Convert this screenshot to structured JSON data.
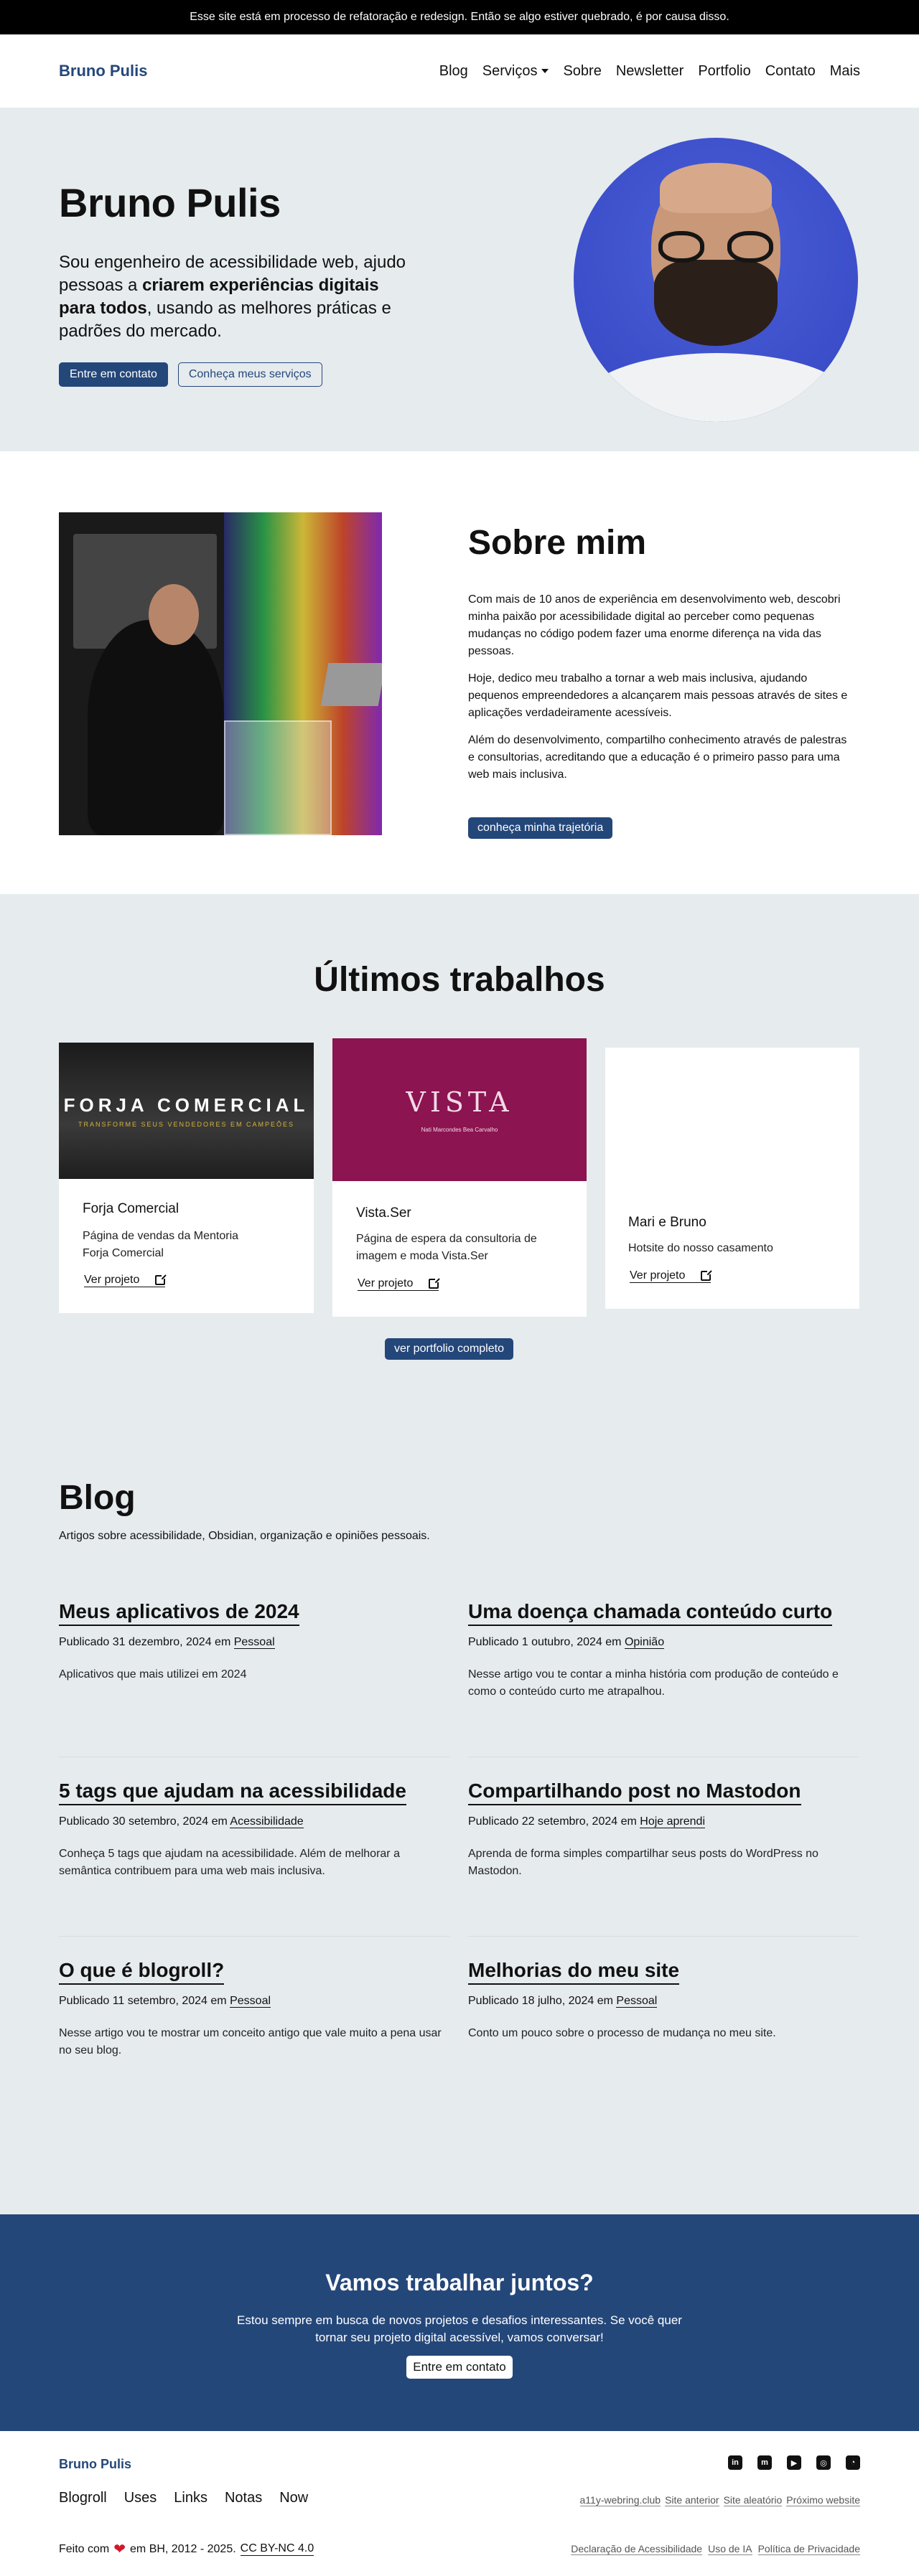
{
  "banner": "Esse site está em processo de refatoração e redesign. Então se algo estiver quebrado, é por causa disso.",
  "header": {
    "brand": "Bruno Pulis",
    "nav": [
      "Blog",
      "Serviços",
      "Sobre",
      "Newsletter",
      "Portfolio",
      "Contato",
      "Mais"
    ]
  },
  "hero": {
    "title": "Bruno Pulis",
    "lead_before": "Sou engenheiro de acessibilidade web, ajudo pessoas a ",
    "lead_bold": "criarem experiências digitais para todos",
    "lead_after": ", usando as melhores práticas e padrões do mercado.",
    "btn_contact": "Entre em contato",
    "btn_services": "Conheça meus serviços"
  },
  "about": {
    "title": "Sobre mim",
    "paragraphs": [
      "Com mais de 10 anos de experiência em desenvolvimento web, descobri minha paixão por acessibilidade digital ao perceber como pequenas mudanças no código podem fazer uma enorme diferença na vida das pessoas.",
      "Hoje, dedico meu trabalho a tornar a web mais inclusiva, ajudando pequenos empreendedores a alcançarem mais pessoas através de sites e aplicações verdadeiramente acessíveis.",
      "Além do desenvolvimento, compartilho conhecimento através de palestras e consultorias, acreditando que a educação é o primeiro passo para uma web mais inclusiva."
    ],
    "button": "conheça minha trajetória"
  },
  "works": {
    "title": "Últimos trabalhos",
    "link_label": "Ver projeto",
    "items": [
      {
        "title": "Forja Comercial",
        "desc": "Página de vendas da Mentoria Forja Comercial",
        "thumb_title": "FORJA COMERCIAL",
        "thumb_sub": "TRANSFORME SEUS VENDEDORES EM CAMPEÕES"
      },
      {
        "title": "Vista.Ser",
        "desc": "Página de espera da consultoria de imagem e moda Vista.Ser",
        "thumb_title": "VISTA",
        "thumb_sub": "Nati Marcondes    Bea Carvalho"
      },
      {
        "title": "Mari e Bruno",
        "desc": "Hotsite do nosso casamento"
      }
    ],
    "button": "ver portfolio completo"
  },
  "blog": {
    "title": "Blog",
    "intro": "Artigos sobre acessibilidade, Obsidian, organização e opiniões pessoais.",
    "in_label": "em",
    "posts": [
      {
        "title": "Meus aplicativos de 2024",
        "date": "Publicado 31 dezembro, 2024",
        "category": "Pessoal",
        "excerpt": "Aplicativos que mais utilizei em 2024"
      },
      {
        "title": "Uma doença chamada conteúdo curto",
        "date": "Publicado 1 outubro, 2024",
        "category": "Opinião",
        "excerpt": "Nesse artigo vou te contar a minha história com produção de conteúdo e como o conteúdo curto me atrapalhou."
      },
      {
        "title": "5 tags que ajudam na acessibilidade",
        "date": "Publicado 30 setembro, 2024",
        "category": "Acessibilidade",
        "excerpt": "Conheça 5 tags que ajudam na acessibilidade. Além de melhorar a semântica contribuem para uma web mais inclusiva."
      },
      {
        "title": "Compartilhando post no Mastodon",
        "date": "Publicado 22 setembro, 2024",
        "category": "Hoje aprendi",
        "excerpt": "Aprenda de forma simples compartilhar seus posts do WordPress no Mastodon."
      },
      {
        "title": "O que é blogroll?",
        "date": "Publicado 11 setembro, 2024",
        "category": "Pessoal",
        "excerpt": "Nesse artigo vou te mostrar um conceito antigo que vale muito a pena usar no seu blog."
      },
      {
        "title": "Melhorias do meu site",
        "date": "Publicado 18 julho, 2024",
        "category": "Pessoal",
        "excerpt": "Conto um pouco sobre o processo de mudança no meu site."
      }
    ]
  },
  "cta": {
    "title": "Vamos trabalhar juntos?",
    "text_line1": "Estou sempre em busca de novos projetos e desafios interessantes. Se você quer",
    "text_line2": "tornar seu projeto digital acessível, vamos conversar!",
    "button": "Entre em contato"
  },
  "footer": {
    "brand": "Bruno Pulis",
    "social": [
      "linkedin-icon",
      "mastodon-icon",
      "youtube-icon",
      "instagram-icon",
      "rss-icon"
    ],
    "nav": [
      "Blogroll",
      "Uses",
      "Links",
      "Notas",
      "Now"
    ],
    "webring": [
      "a11y-webring.club",
      "Site anterior",
      "Site aleatório",
      "Próximo website"
    ],
    "copy_before": "Feito com",
    "copy_after": "em BH, 2012 - 2025.",
    "license": "CC BY-NC 4.0",
    "legal": [
      "Declaração de Acessibilidade",
      "Uso de IA",
      "Política de Privacidade"
    ]
  },
  "colors": {
    "brand": "#24477a",
    "bg_muted": "#e6ebee",
    "banner_bg": "#000000"
  }
}
